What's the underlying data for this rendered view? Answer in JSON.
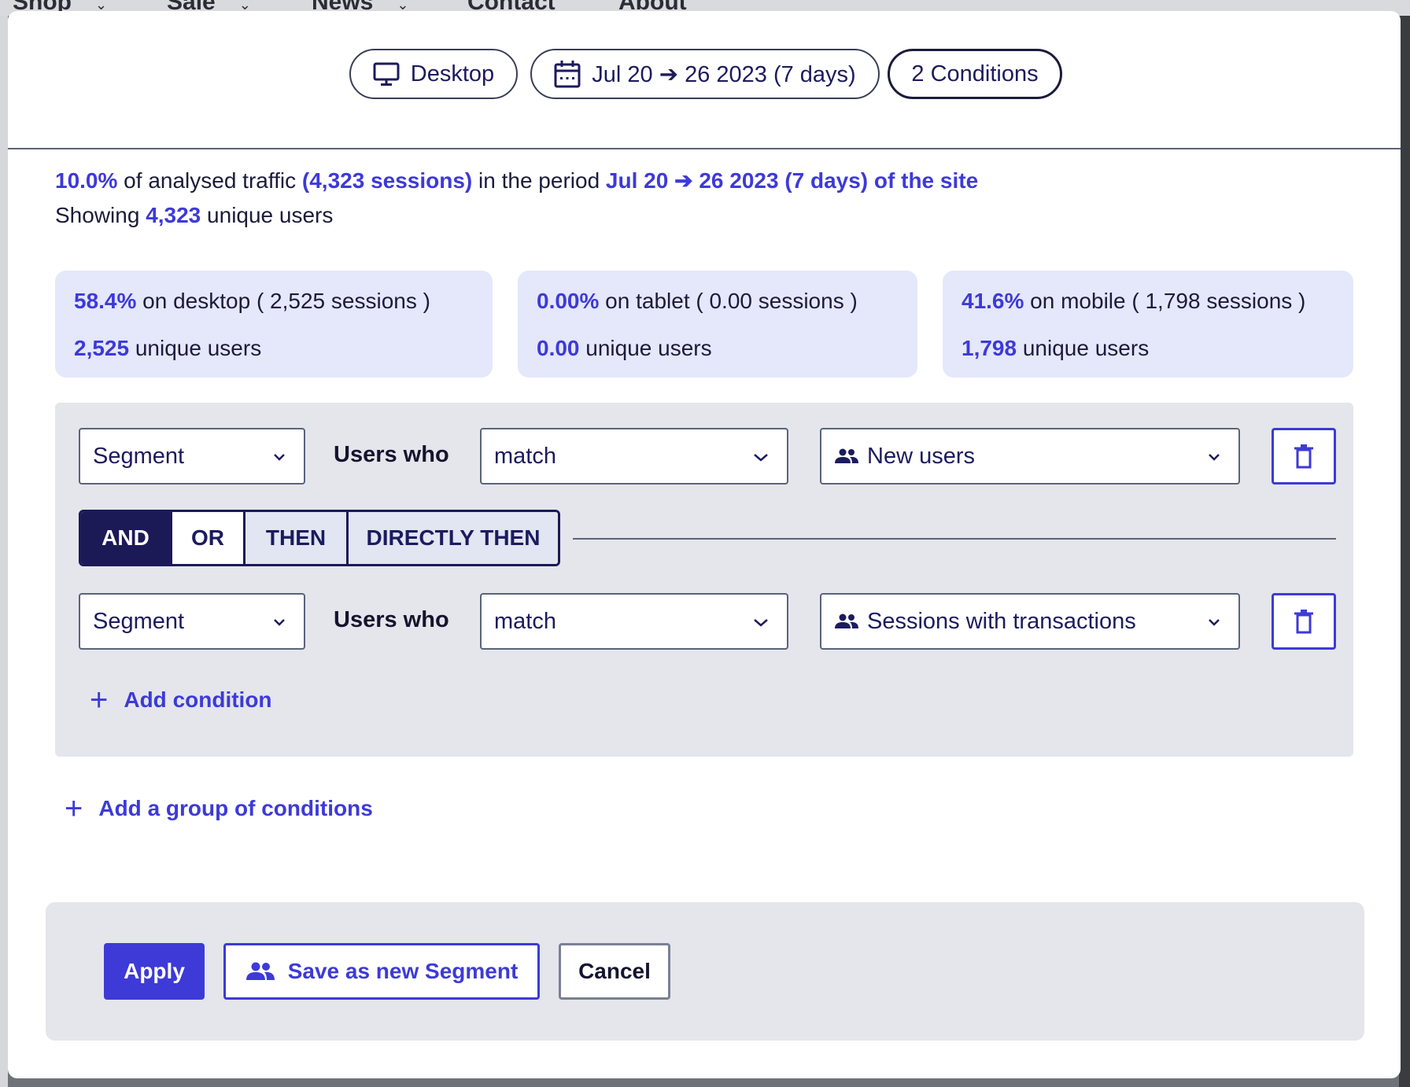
{
  "site_nav": {
    "items": [
      {
        "label": "Shop",
        "has_dropdown": true
      },
      {
        "label": "Sale",
        "has_dropdown": true
      },
      {
        "label": "News",
        "has_dropdown": true
      },
      {
        "label": "Contact",
        "has_dropdown": false
      },
      {
        "label": "About",
        "has_dropdown": false
      }
    ]
  },
  "filters": {
    "device": "Desktop",
    "date_range": "Jul 20 ➔ 26 2023 (7 days)",
    "conditions": "2 Conditions"
  },
  "summary": {
    "percent": "10.0%",
    "text1": " of analysed traffic ",
    "sessions": "(4,323 sessions)",
    "text2": " in the period ",
    "period": "Jul 20 ➔ 26 2023 (7 days) of the site",
    "showing": "Showing ",
    "unique_users": "4,323",
    "unique_label": " unique users"
  },
  "devices": [
    {
      "percent": "58.4%",
      "label": " on desktop ( 2,525 sessions )",
      "users": "2,525",
      "users_label": " unique users"
    },
    {
      "percent": "0.00%",
      "label": " on tablet ( 0.00 sessions )",
      "users": "0.00",
      "users_label": " unique users"
    },
    {
      "percent": "41.6%",
      "label": " on mobile ( 1,798 sessions )",
      "users": "1,798",
      "users_label": " unique users"
    }
  ],
  "conditions": [
    {
      "type": "Segment",
      "users_who": "Users who",
      "operator": "match",
      "value": "New users"
    },
    {
      "type": "Segment",
      "users_who": "Users who",
      "operator": "match",
      "value": "Sessions with transactions"
    }
  ],
  "logic_options": [
    {
      "label": "AND",
      "state": "active"
    },
    {
      "label": "OR",
      "state": "normal"
    },
    {
      "label": "THEN",
      "state": "muted"
    },
    {
      "label": "DIRECTLY THEN",
      "state": "muted"
    }
  ],
  "add_condition": "Add condition",
  "add_group": "Add a group of conditions",
  "actions": {
    "apply": "Apply",
    "save_segment": "Save as new Segment",
    "cancel": "Cancel"
  },
  "colors": {
    "accent": "#3d3ad8",
    "navy": "#1b1a57",
    "card_bg": "#e5e7fa",
    "panel_bg": "#e4e6ec"
  }
}
